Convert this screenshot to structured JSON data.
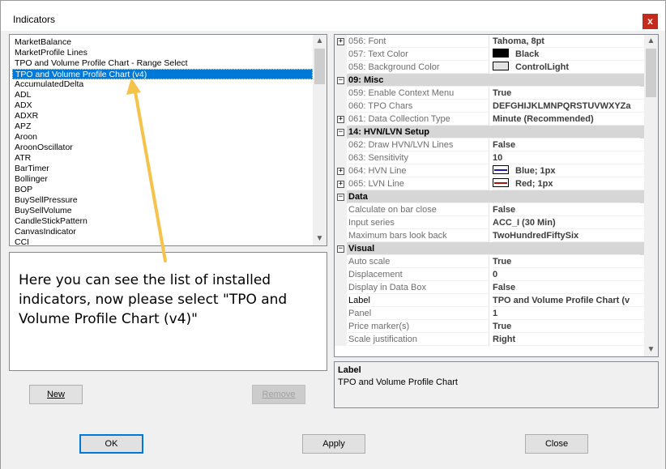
{
  "window": {
    "title": "Indicators",
    "close_symbol": "x"
  },
  "indicator_list": {
    "items": [
      "MarketBalance",
      "MarketProfile Lines",
      "TPO and Volume Profile Chart - Range Select",
      "TPO and Volume Profile Chart (v4)",
      "AccumulatedDelta",
      "ADL",
      "ADX",
      "ADXR",
      "APZ",
      "Aroon",
      "AroonOscillator",
      "ATR",
      "BarTimer",
      "Bollinger",
      "BOP",
      "BuySellPressure",
      "BuySellVolume",
      "CandleStickPattern",
      "CanvasIndicator",
      "CCI"
    ],
    "selected_index": 3
  },
  "annotation": {
    "text": "Here you can see the list of installed indicators, now please select \"TPO and Volume Profile Chart (v4)\"",
    "arrow_color": "#f5c24a"
  },
  "buttons": {
    "new": "New",
    "remove": "Remove",
    "ok": "OK",
    "apply": "Apply",
    "close": "Close"
  },
  "properties": {
    "rows": [
      {
        "type": "prop",
        "expand": "+",
        "name": "056: Font",
        "value": "Tahoma, 8pt"
      },
      {
        "type": "prop",
        "name": "057: Text Color",
        "value": "Black",
        "swatch": "#000000"
      },
      {
        "type": "prop",
        "name": "058: Background Color",
        "value": "ControlLight",
        "swatch": "#e3e3e3"
      },
      {
        "type": "cat",
        "expand": "−",
        "name": "09: Misc"
      },
      {
        "type": "prop",
        "name": "059: Enable Context Menu",
        "value": "True"
      },
      {
        "type": "prop",
        "name": "060: TPO Chars",
        "value": "DEFGHIJKLMNPQRSTUVWXYZa"
      },
      {
        "type": "prop",
        "expand": "+",
        "name": "061: Data Collection Type",
        "value": "Minute (Recommended)"
      },
      {
        "type": "cat",
        "expand": "−",
        "name": "14: HVN/LVN Setup"
      },
      {
        "type": "prop",
        "name": "062: Draw HVN/LVN Lines",
        "value": "False"
      },
      {
        "type": "prop",
        "name": "063: Sensitivity",
        "value": "10"
      },
      {
        "type": "prop",
        "expand": "+",
        "name": "064: HVN Line",
        "value": "Blue; 1px",
        "line": "#1a1aa0"
      },
      {
        "type": "prop",
        "expand": "+",
        "name": "065: LVN Line",
        "value": "Red; 1px",
        "line": "#b01010"
      },
      {
        "type": "cat",
        "expand": "−",
        "name": "Data"
      },
      {
        "type": "prop",
        "name": "Calculate on bar close",
        "value": "False"
      },
      {
        "type": "prop",
        "name": "Input series",
        "value": "ACC_I (30 Min)"
      },
      {
        "type": "prop",
        "name": "Maximum bars look back",
        "value": "TwoHundredFiftySix"
      },
      {
        "type": "cat",
        "expand": "−",
        "name": "Visual"
      },
      {
        "type": "prop",
        "name": "Auto scale",
        "value": "True"
      },
      {
        "type": "prop",
        "name": "Displacement",
        "value": "0"
      },
      {
        "type": "prop",
        "name": "Display in Data Box",
        "value": "False"
      },
      {
        "type": "prop",
        "name": "Label",
        "value": "TPO and Volume Profile Chart (v",
        "highlight": true
      },
      {
        "type": "prop",
        "name": "Panel",
        "value": "1"
      },
      {
        "type": "prop",
        "name": "Price marker(s)",
        "value": "True"
      },
      {
        "type": "prop",
        "name": "Scale justification",
        "value": "Right"
      }
    ]
  },
  "help": {
    "title": "Label",
    "text": "TPO and Volume Profile Chart"
  }
}
